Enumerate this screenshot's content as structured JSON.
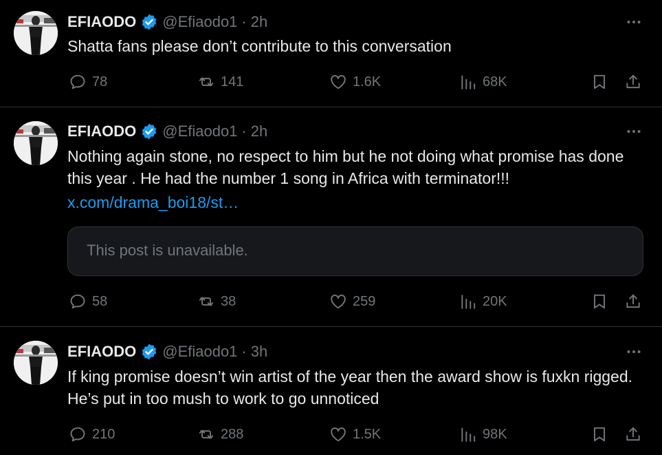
{
  "tweets": [
    {
      "name": "EFIAODO",
      "handle": "@Efiaodo1",
      "separator": "·",
      "time": "2h",
      "text": "Shatta fans please don’t contribute to this conversation",
      "replies": "78",
      "reposts": "141",
      "likes": "1.6K",
      "views": "68K"
    },
    {
      "name": "EFIAODO",
      "handle": "@Efiaodo1",
      "separator": "·",
      "time": "2h",
      "text": "Nothing again stone, no respect to him but he not doing what promise has done this year . He had the number 1 song in Africa with terminator!!!",
      "link": "x.com/drama_boi18/st…",
      "quoted_unavailable": "This post is unavailable.",
      "replies": "58",
      "reposts": "38",
      "likes": "259",
      "views": "20K"
    },
    {
      "name": "EFIAODO",
      "handle": "@Efiaodo1",
      "separator": "·",
      "time": "3h",
      "text": "If king promise doesn’t win artist of the year then the award show is fuxkn rigged. He’s put in too mush to work to go unnoticed",
      "replies": "210",
      "reposts": "288",
      "likes": "1.5K",
      "views": "98K"
    }
  ],
  "colors": {
    "background": "#000000",
    "text": "#e7e9ea",
    "muted": "#71767b",
    "link": "#1d9bf0",
    "verified": "#1d9bf0",
    "divider": "#2f3336"
  },
  "icons": [
    "verified-badge-icon",
    "more-icon",
    "reply-icon",
    "repost-icon",
    "like-icon",
    "views-icon",
    "bookmark-icon",
    "share-icon"
  ]
}
